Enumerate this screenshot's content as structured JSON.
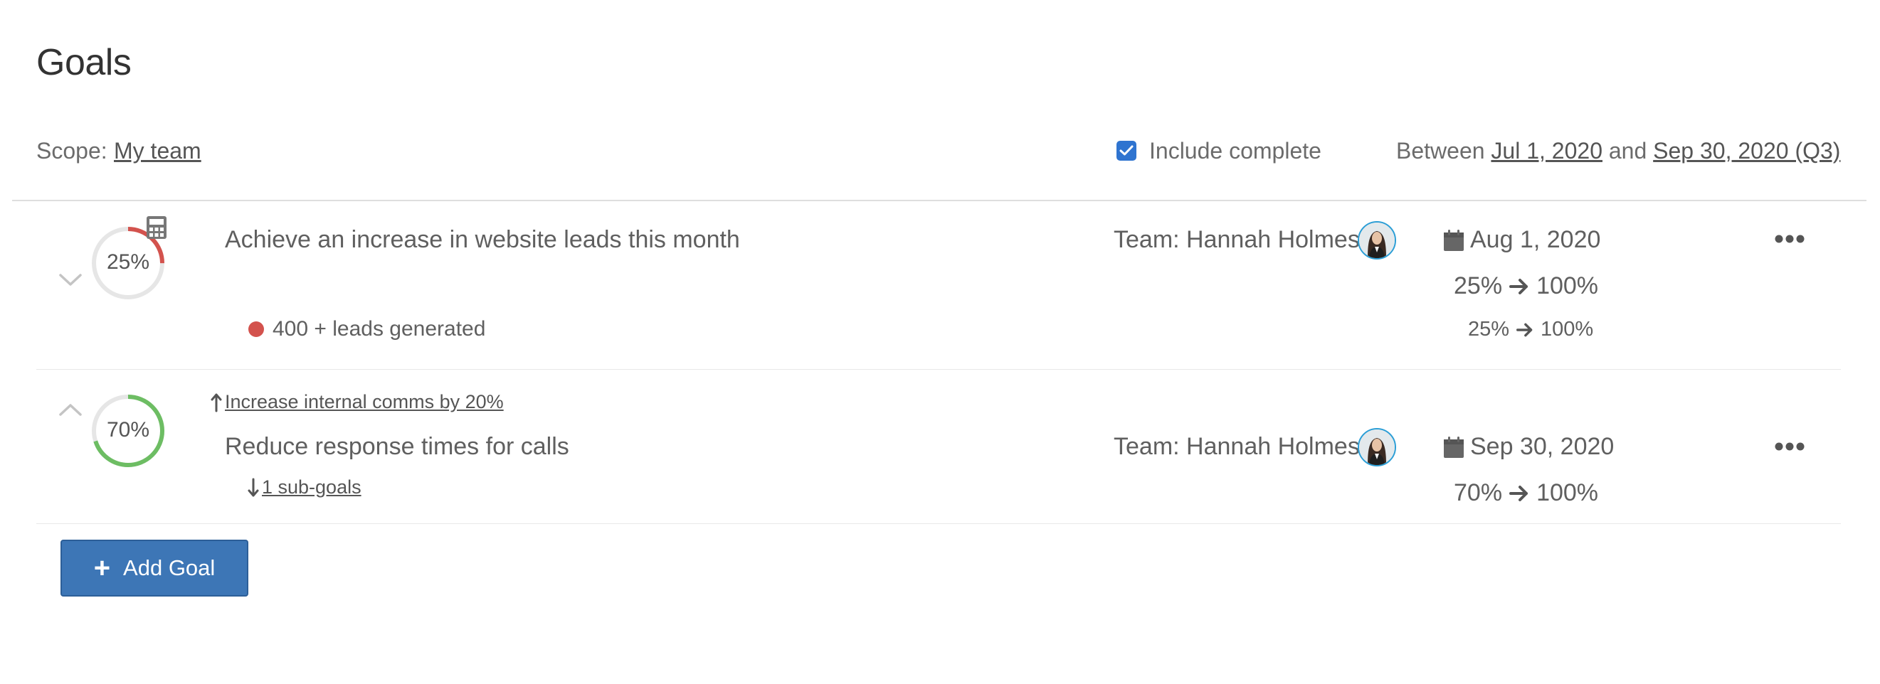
{
  "page": {
    "title": "Goals"
  },
  "filters": {
    "scope_label": "Scope:",
    "scope_value": "My team",
    "include_complete_label": "Include complete",
    "include_complete_checked": true,
    "range_prefix": "Between",
    "range_start": "Jul 1, 2020",
    "range_and": "and",
    "range_end": "Sep 30, 2020 (Q3)"
  },
  "goals": [
    {
      "progress_text": "25%",
      "progress": 0.25,
      "ring_color": "#d3524d",
      "title": "Achieve an increase in website leads this month",
      "owner": "Team: Hannah Holmes",
      "due": "Aug 1, 2020",
      "progress_from": "25%",
      "progress_to": "100%",
      "key_result": {
        "label": "400 + leads generated",
        "color": "#d3524d",
        "from": "25%",
        "to": "100%"
      },
      "calculator_icon": "calculator-icon"
    },
    {
      "progress_text": "70%",
      "progress": 0.7,
      "ring_color": "#6dbd63",
      "parent_goal": "Increase internal comms by 20%",
      "title": "Reduce response times for calls",
      "owner": "Team: Hannah Holmes",
      "due": "Sep 30, 2020",
      "progress_from": "70%",
      "progress_to": "100%",
      "sub_goals": "1 sub-goals"
    }
  ],
  "actions": {
    "add_goal": "Add Goal"
  },
  "colors": {
    "accent": "#3d76b6",
    "checkbox": "#2f74d0",
    "track": "#e6e6e6"
  }
}
